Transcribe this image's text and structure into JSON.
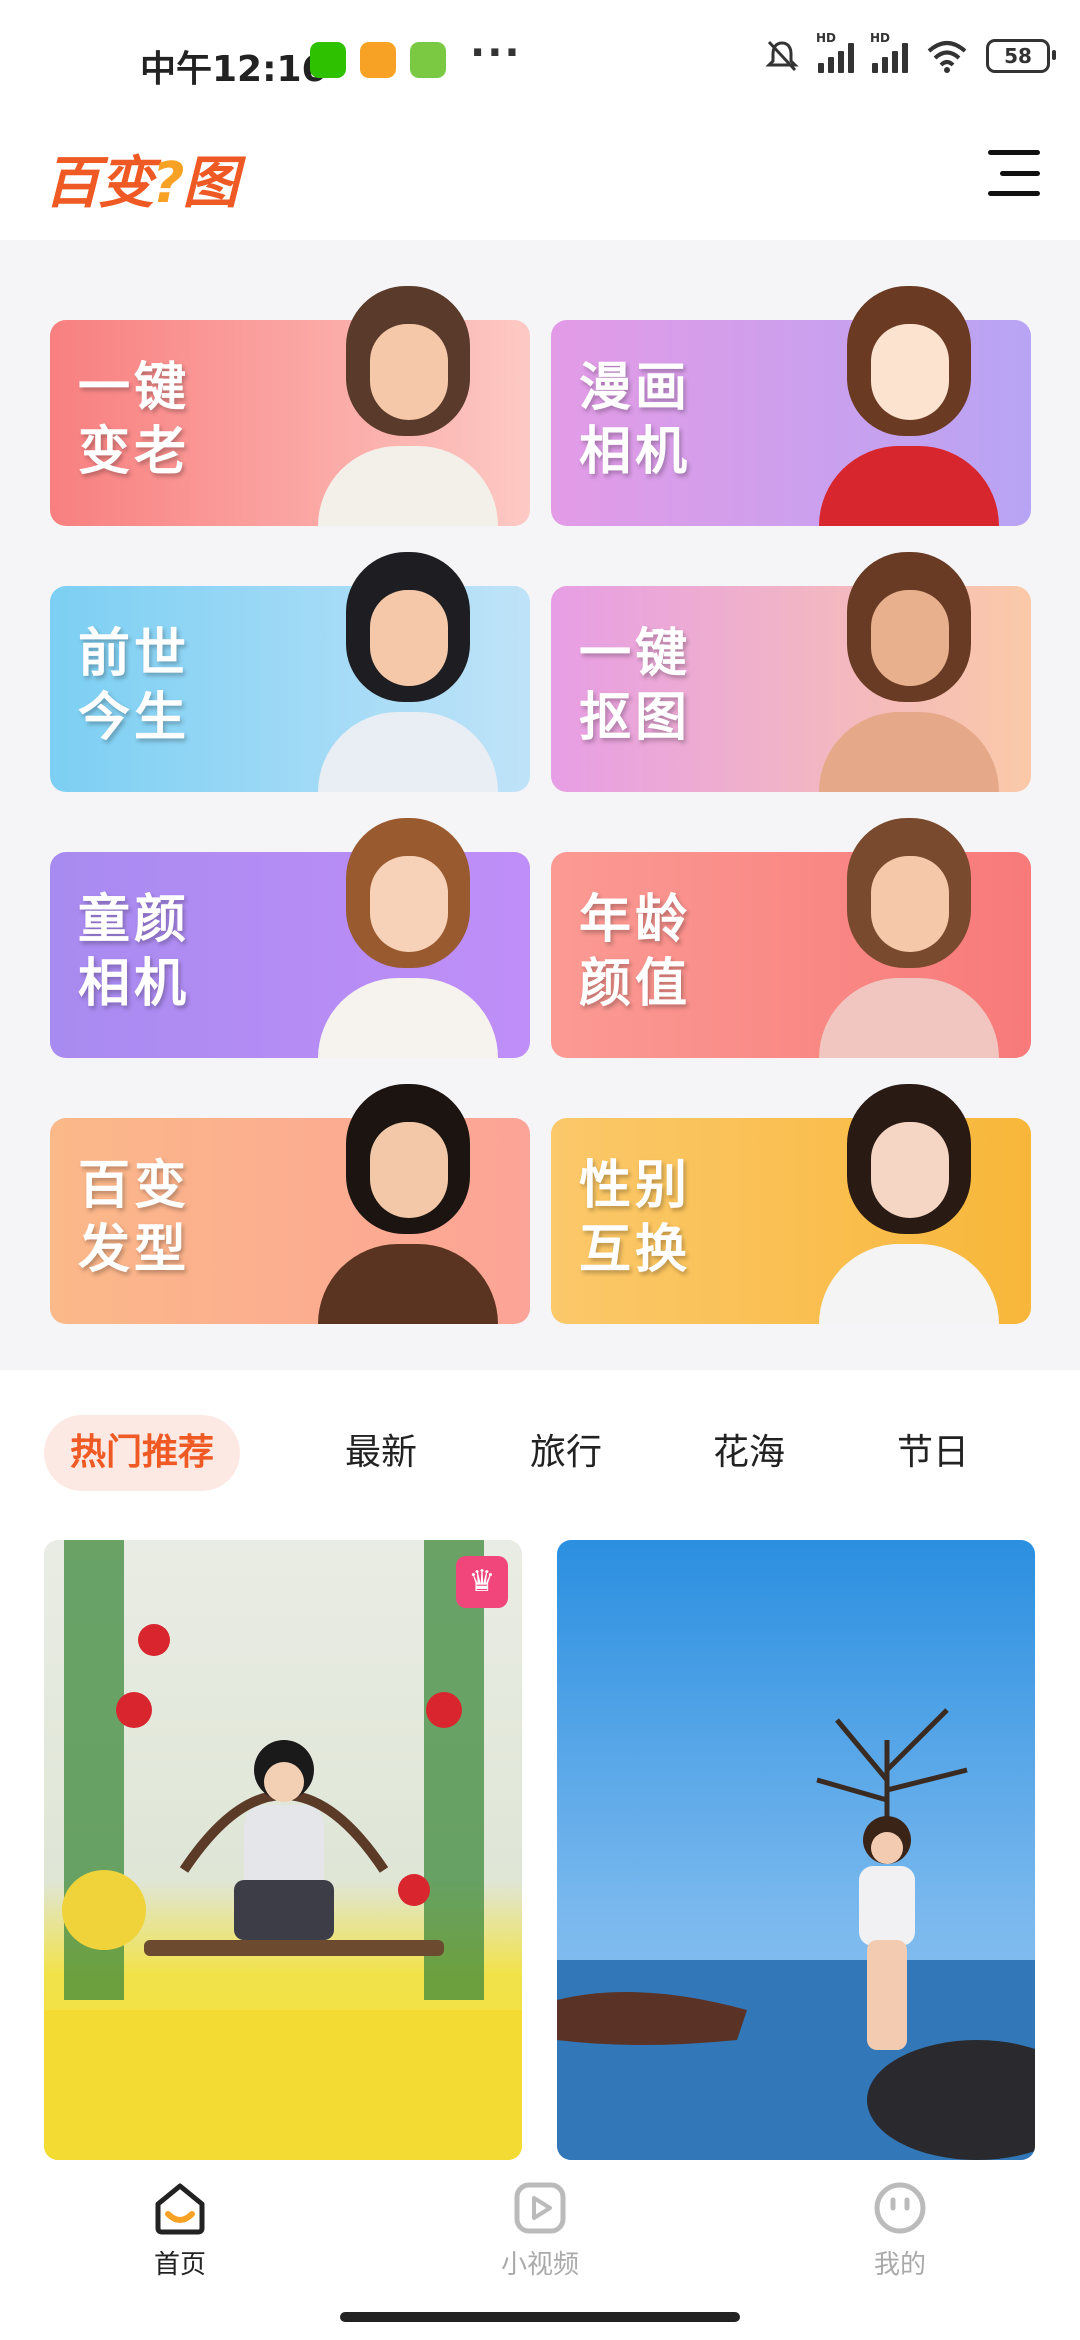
{
  "status_bar": {
    "time": "中午12:16",
    "battery": "58",
    "signal_label": "HD"
  },
  "header": {
    "logo_text_a": "百变",
    "logo_q": "?",
    "logo_text_b": "图"
  },
  "features": [
    {
      "label": "一键变老"
    },
    {
      "label": "漫画相机"
    },
    {
      "label": "前世今生"
    },
    {
      "label": "一键抠图"
    },
    {
      "label": "童颜相机"
    },
    {
      "label": "年龄颜值"
    },
    {
      "label": "百变发型"
    },
    {
      "label": "性别互换"
    }
  ],
  "tabs": [
    {
      "label": "热门推荐"
    },
    {
      "label": "最新"
    },
    {
      "label": "旅行"
    },
    {
      "label": "花海"
    },
    {
      "label": "节日"
    }
  ],
  "bottom_nav": [
    {
      "label": "首页"
    },
    {
      "label": "小视频"
    },
    {
      "label": "我的"
    }
  ]
}
